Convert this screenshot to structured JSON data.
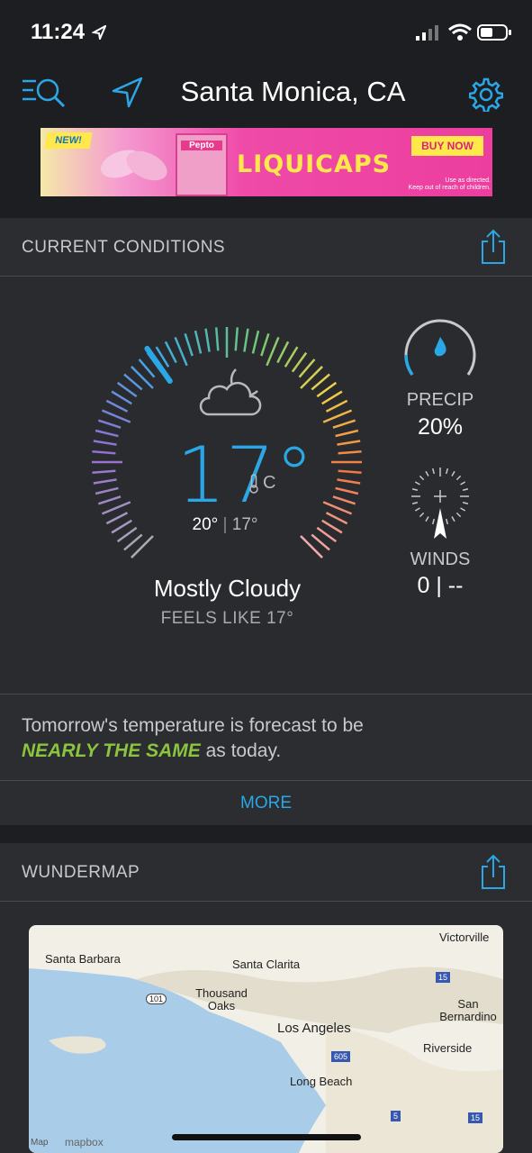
{
  "status": {
    "time": "11:24"
  },
  "header": {
    "city": "Santa Monica, CA"
  },
  "ad": {
    "badge": "NEW!",
    "brand": "Pepto",
    "product": "LIQUICAPS",
    "cta": "BUY NOW",
    "fine1": "Use as directed.",
    "fine2": "Keep out of reach of children."
  },
  "conditions": {
    "section_title": "CURRENT CONDITIONS",
    "temp": "17°",
    "unit": "C",
    "high": "20°",
    "low": "17°",
    "condition": "Mostly Cloudy",
    "feels_like": "FEELS LIKE 17°",
    "precip_label": "PRECIP",
    "precip_value": "20%",
    "winds_label": "WINDS",
    "winds_value": "0 | --"
  },
  "forecast": {
    "prefix": "Tomorrow's temperature is forecast to be",
    "highlight": "NEARLY THE SAME",
    "suffix": " as today."
  },
  "more_label": "MORE",
  "wundermap": {
    "section_title": "WUNDERMAP",
    "labels": [
      "Victorville",
      "Santa Barbara",
      "Santa Clarita",
      "Thousand Oaks",
      "Los Angeles",
      "San Bernardino",
      "Riverside",
      "Long Beach"
    ],
    "highways": [
      "101",
      "15",
      "605",
      "5",
      "5",
      "15"
    ],
    "attribution_map": "Map",
    "attribution_mapbox": "mapbox"
  },
  "colors": {
    "accent": "#2aa7e6",
    "highlight": "#8bc43f",
    "bg": "#2a2b2f"
  }
}
